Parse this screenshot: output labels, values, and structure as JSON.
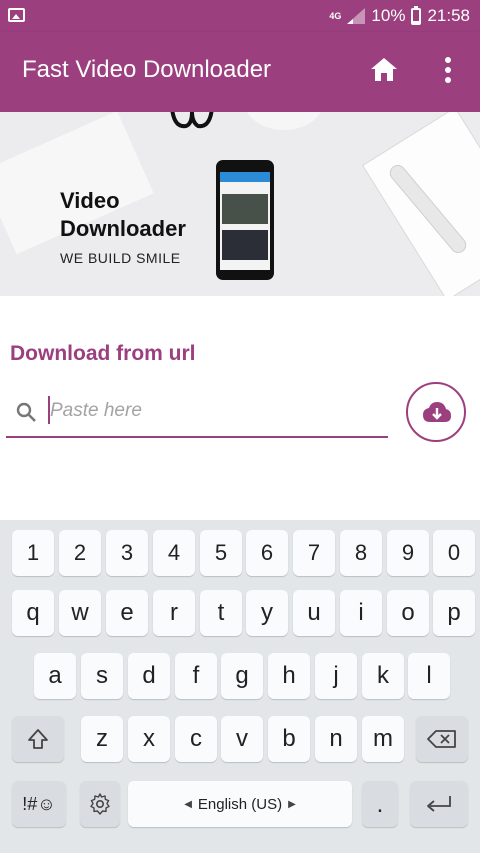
{
  "status_bar": {
    "network": "4G",
    "battery": "10%",
    "time": "21:58"
  },
  "app_bar": {
    "title": "Fast Video Downloader"
  },
  "banner": {
    "title_line1": "Video",
    "title_line2": "Downloader",
    "tagline": "WE BUILD SMILE"
  },
  "download": {
    "section_title": "Download from url",
    "input_placeholder": "Paste here",
    "input_value": ""
  },
  "keyboard": {
    "number_row": [
      "1",
      "2",
      "3",
      "4",
      "5",
      "6",
      "7",
      "8",
      "9",
      "0"
    ],
    "row1": [
      "q",
      "w",
      "e",
      "r",
      "t",
      "y",
      "u",
      "i",
      "o",
      "p"
    ],
    "row2": [
      "a",
      "s",
      "d",
      "f",
      "g",
      "h",
      "j",
      "k",
      "l"
    ],
    "row3": [
      "z",
      "x",
      "c",
      "v",
      "b",
      "n",
      "m"
    ],
    "symbols_key": "!#☺",
    "language": "English (US)",
    "period": "."
  },
  "colors": {
    "accent": "#9b3f7f",
    "keyboard_bg": "#e3e6e9",
    "key_bg": "#fafbfc"
  }
}
